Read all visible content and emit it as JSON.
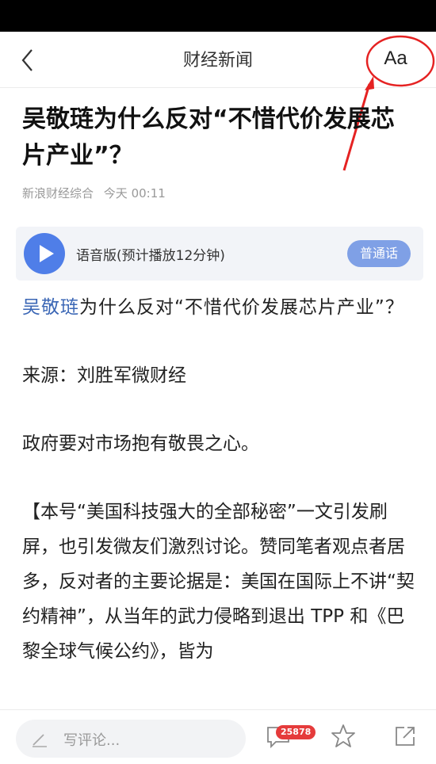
{
  "nav": {
    "title": "财经新闻",
    "font_button": "Aa"
  },
  "article": {
    "headline": "吴敬琏为什么反对“不惜代价发展芯片产业”？",
    "source": "新浪财经综合",
    "time": "今天 00:11",
    "audio": {
      "label": "语音版(预计播放12分钟)",
      "voice_button": "普通话"
    },
    "body": {
      "p1_link": "吴敬琏",
      "p1_rest": "为什么反对“不惜代价发展芯片产业”？",
      "p2": "来源：刘胜军微财经",
      "p3": "政府要对市场抱有敬畏之心。",
      "p4": "【本号“美国科技强大的全部秘密”一文引发刷屏，也引发微友们激烈讨论。赞同笔者观点者居多，反对者的主要论据是：美国在国际上不讲“契约精神”，从当年的武力侵略到退出 TPP 和《巴黎全球气候公约》，皆为"
    }
  },
  "bottom": {
    "comment_placeholder": "写评论...",
    "comment_count": "25878"
  },
  "colors": {
    "accent": "#4f7ee8",
    "link": "#3a66b5",
    "badge": "#e53b3b",
    "annotation": "#e52222"
  },
  "icons": [
    "back-arrow-icon",
    "play-icon",
    "pen-icon",
    "comment-icon",
    "star-icon",
    "share-icon"
  ]
}
